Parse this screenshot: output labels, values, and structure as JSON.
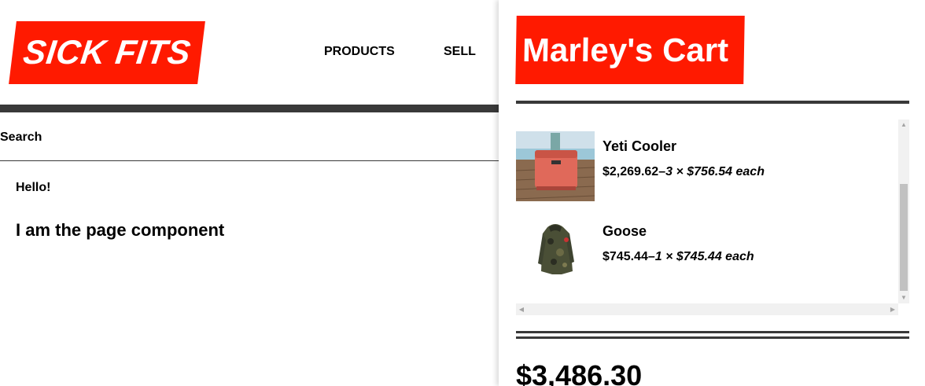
{
  "header": {
    "logo": "SICK FITS",
    "nav": [
      {
        "label": "PRODUCTS"
      },
      {
        "label": "SELL"
      }
    ]
  },
  "search": {
    "label": "Search"
  },
  "page": {
    "hello": "Hello!",
    "heading": "I am the page component"
  },
  "cart": {
    "title": "Marley's Cart",
    "items": [
      {
        "name": "Yeti Cooler",
        "line_total": "$2,269.62",
        "breakdown": "3 × $756.54 each",
        "image": "cooler-photo"
      },
      {
        "name": "Goose",
        "line_total": "$745.44",
        "breakdown": "1 × $745.44 each",
        "image": "camo-jacket-photo"
      }
    ],
    "total": "$3,486.30"
  },
  "colors": {
    "brand_red": "#ff1a00",
    "bar_dark": "#393939"
  }
}
